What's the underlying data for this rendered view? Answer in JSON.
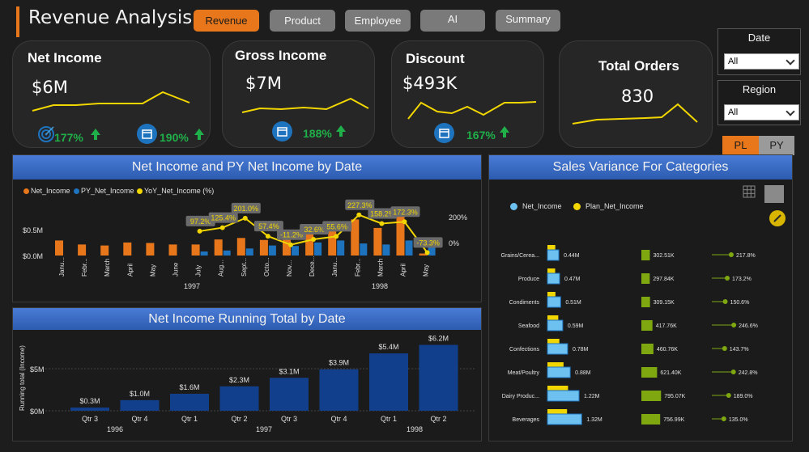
{
  "header": {
    "title": "Revenue Analysis",
    "nav": [
      "Revenue",
      "Product",
      "Employee",
      "AI",
      "Summary"
    ],
    "active_nav": "Revenue"
  },
  "kpis": {
    "net_income": {
      "title": "Net Income",
      "value": "$6M",
      "pct_left": "177%",
      "pct_right": "190%"
    },
    "gross_income": {
      "title": "Gross Income",
      "value": "$7M",
      "pct": "188%"
    },
    "discount": {
      "title": "Discount",
      "value": "$493K",
      "pct": "167%"
    },
    "total_orders": {
      "title": "Total Orders",
      "value": "830"
    }
  },
  "filters": {
    "date": {
      "label": "Date",
      "value": "All"
    },
    "region": {
      "label": "Region",
      "value": "All"
    }
  },
  "toggle": {
    "pl": "PL",
    "py": "PY"
  },
  "colors": {
    "accent": "#e8771b",
    "blue": "#1e73be",
    "yellow": "#f2d600",
    "green": "#20b04a",
    "header_blue": "#3a6cc4"
  },
  "chart1": {
    "header": "Net Income and PY Net Income by Date",
    "legend": [
      "Net_Income",
      "PY_Net_Income",
      "YoY_Net_Income (%)"
    ],
    "y_left_ticks": [
      "$0.5M",
      "$0.0M"
    ],
    "y_right_ticks": [
      "200%",
      "0%"
    ],
    "year_labels": [
      "1997",
      "1998"
    ]
  },
  "chart2": {
    "header": "Net Income Running Total by Date",
    "ylabel": "Running total (Income)",
    "y_ticks": [
      "$5M",
      "$0M"
    ],
    "year_labels": [
      "1996",
      "1997",
      "1998"
    ]
  },
  "chart3": {
    "header": "Sales Variance For Categories",
    "legend": [
      "Net_Income",
      "Plan_Net_Income"
    ]
  },
  "chart_data": [
    {
      "type": "bar",
      "title": "Net Income and PY Net Income by Date",
      "categories": [
        "Janu...",
        "Febr...",
        "March",
        "April",
        "May",
        "June",
        "July",
        "Aug...",
        "Sept...",
        "Octo...",
        "Nov...",
        "Dece...",
        "Janu...",
        "Febr...",
        "March",
        "April",
        "May"
      ],
      "series": [
        {
          "name": "Net_Income",
          "values": [
            0.3,
            0.22,
            0.2,
            0.26,
            0.25,
            0.22,
            0.22,
            0.32,
            0.35,
            0.31,
            0.38,
            0.42,
            0.55,
            0.72,
            0.55,
            0.88,
            0.04
          ]
        },
        {
          "name": "PY_Net_Income",
          "values": [
            0,
            0,
            0,
            0,
            0,
            0,
            0.08,
            0.1,
            0.14,
            0.2,
            0.19,
            0.26,
            0.3,
            0.24,
            0.22,
            0.3,
            0.25
          ]
        },
        {
          "name": "YoY_Net_Income (%)",
          "values": [
            null,
            null,
            null,
            null,
            null,
            null,
            97.2,
            125.4,
            201.0,
            57.4,
            -11.2,
            32.6,
            55.6,
            227.3,
            158.2,
            172.3,
            -73.3
          ]
        }
      ],
      "data_labels": [
        "97.2%",
        "125.4%",
        "201.0%",
        "57.4%",
        "-11.2%",
        "32.6%",
        "55.6%",
        "227.3%",
        "158.2%",
        "172.3%",
        "-73.3%"
      ],
      "ylim": [
        0,
        1.0
      ],
      "y2lim": [
        -100,
        300
      ]
    },
    {
      "type": "bar",
      "title": "Net Income Running Total by Date",
      "categories": [
        "Qtr 3",
        "Qtr 4",
        "Qtr 1",
        "Qtr 2",
        "Qtr 3",
        "Qtr 4",
        "Qtr 1",
        "Qtr 2"
      ],
      "values": [
        0.3,
        1.0,
        1.6,
        2.3,
        3.1,
        3.9,
        5.4,
        6.2
      ],
      "data_labels": [
        "$0.3M",
        "$1.0M",
        "$1.6M",
        "$2.3M",
        "$3.1M",
        "$3.9M",
        "$5.4M",
        "$6.2M"
      ],
      "ylabel": "Running total (Income)",
      "ylim": [
        0,
        7
      ]
    },
    {
      "type": "table",
      "title": "Sales Variance For Categories",
      "rows": [
        {
          "category": "Grains/Cerea...",
          "net_income": "0.44M",
          "plan": "302.51K",
          "variance": "217.8%",
          "net_v": 0.44,
          "plan_v": 0.30251,
          "var_v": 217.8
        },
        {
          "category": "Produce",
          "net_income": "0.47M",
          "plan": "297.84K",
          "variance": "173.2%",
          "net_v": 0.47,
          "plan_v": 0.29784,
          "var_v": 173.2
        },
        {
          "category": "Condiments",
          "net_income": "0.51M",
          "plan": "309.15K",
          "variance": "150.6%",
          "net_v": 0.51,
          "plan_v": 0.30915,
          "var_v": 150.6
        },
        {
          "category": "Seafood",
          "net_income": "0.59M",
          "plan": "417.76K",
          "variance": "246.6%",
          "net_v": 0.59,
          "plan_v": 0.41776,
          "var_v": 246.6
        },
        {
          "category": "Confections",
          "net_income": "0.78M",
          "plan": "460.76K",
          "variance": "143.7%",
          "net_v": 0.78,
          "plan_v": 0.46076,
          "var_v": 143.7
        },
        {
          "category": "Meat/Poultry",
          "net_income": "0.88M",
          "plan": "621.40K",
          "variance": "242.8%",
          "net_v": 0.88,
          "plan_v": 0.6214,
          "var_v": 242.8
        },
        {
          "category": "Dairy Produc...",
          "net_income": "1.22M",
          "plan": "795.07K",
          "variance": "189.0%",
          "net_v": 1.22,
          "plan_v": 0.79507,
          "var_v": 189.0
        },
        {
          "category": "Beverages",
          "net_income": "1.32M",
          "plan": "756.99K",
          "variance": "135.0%",
          "net_v": 1.32,
          "plan_v": 0.75699,
          "var_v": 135.0
        }
      ]
    }
  ]
}
